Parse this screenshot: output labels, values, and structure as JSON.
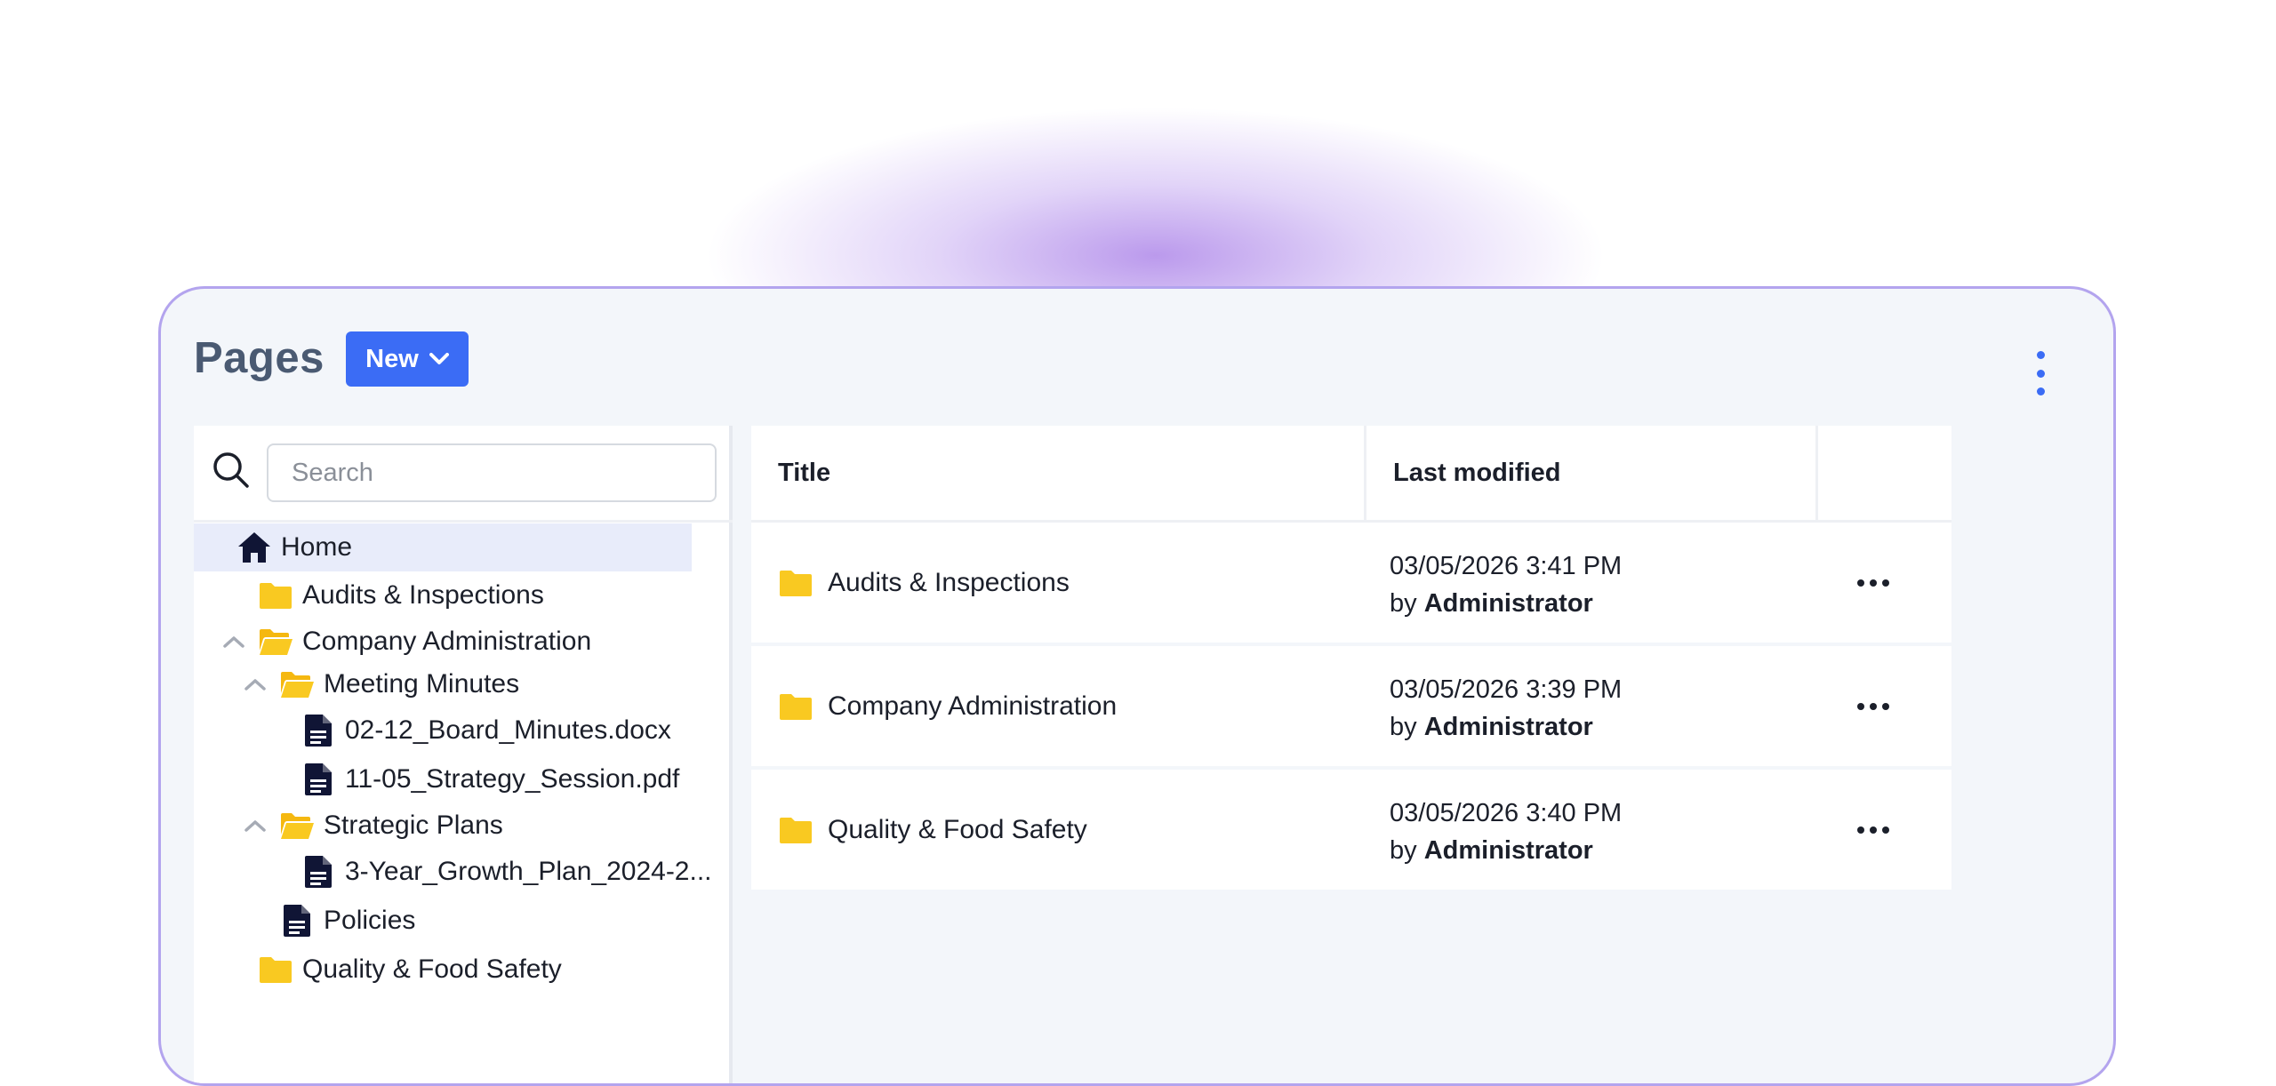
{
  "header": {
    "title": "Pages",
    "new_button_label": "New"
  },
  "search": {
    "placeholder": "Search",
    "value": ""
  },
  "tree": {
    "items": [
      {
        "label": "Home",
        "icon": "home-icon",
        "selected": true
      },
      {
        "label": "Audits & Inspections",
        "icon": "folder-icon"
      },
      {
        "label": "Company Administration",
        "icon": "folder-open-icon",
        "expanded": true
      },
      {
        "label": "Meeting Minutes",
        "icon": "folder-open-icon",
        "expanded": true
      },
      {
        "label": "02-12_Board_Minutes.docx",
        "icon": "document-icon"
      },
      {
        "label": "11-05_Strategy_Session.pdf",
        "icon": "document-icon"
      },
      {
        "label": "Strategic Plans",
        "icon": "folder-open-icon",
        "expanded": true
      },
      {
        "label": "3-Year_Growth_Plan_2024-2...",
        "icon": "document-icon"
      },
      {
        "label": "Policies",
        "icon": "document-icon"
      },
      {
        "label": "Quality & Food Safety",
        "icon": "folder-icon"
      }
    ]
  },
  "table": {
    "columns": {
      "title": "Title",
      "last_modified": "Last modified"
    },
    "rows": [
      {
        "title": "Audits & Inspections",
        "date": "03/05/2026",
        "time": "3:41 PM",
        "by": "by",
        "author": "Administrator"
      },
      {
        "title": "Company Administration",
        "date": "03/05/2026",
        "time": "3:39 PM",
        "by": "by",
        "author": "Administrator"
      },
      {
        "title": "Quality & Food Safety",
        "date": "03/05/2026",
        "time": "3:40 PM",
        "by": "by",
        "author": "Administrator"
      }
    ]
  },
  "colors": {
    "accent": "#3b6cf5",
    "folder": "#f9c921",
    "document": "#101535",
    "card_border": "#b3a4ee",
    "title_text": "#4a5a72"
  }
}
